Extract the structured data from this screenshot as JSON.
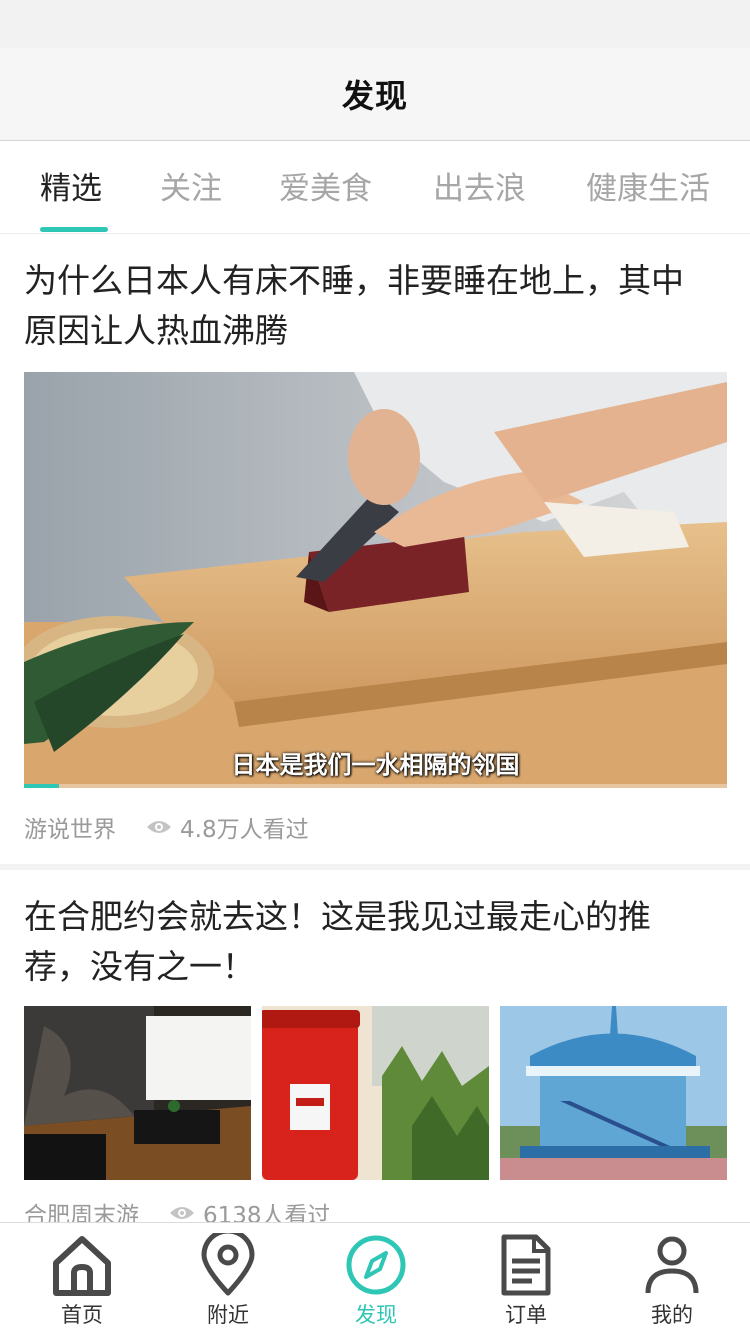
{
  "header": {
    "title": "发现"
  },
  "tabs": [
    {
      "label": "精选",
      "active": true
    },
    {
      "label": "关注"
    },
    {
      "label": "爱美食"
    },
    {
      "label": "出去浪"
    },
    {
      "label": "健康生活"
    }
  ],
  "feed": [
    {
      "title": "为什么日本人有床不睡，非要睡在地上，其中原因让人热血沸腾",
      "video_subtitle": "日本是我们一水相隔的邻国",
      "source": "游说世界",
      "views": "4.8万人看过",
      "progress": 0.05
    },
    {
      "title": "在合肥约会就去这！这是我见过最走心的推荐，没有之一！",
      "source": "合肥周末游",
      "views": "6138人看过"
    }
  ],
  "bottom_nav": [
    {
      "label": "首页",
      "icon": "home-icon"
    },
    {
      "label": "附近",
      "icon": "location-pin-icon"
    },
    {
      "label": "发现",
      "icon": "compass-icon",
      "active": true
    },
    {
      "label": "订单",
      "icon": "document-icon"
    },
    {
      "label": "我的",
      "icon": "user-icon"
    }
  ],
  "colors": {
    "accent": "#2ec6b5",
    "inactive_text": "#a6a6a6",
    "meta_text": "#9a9a9a"
  }
}
